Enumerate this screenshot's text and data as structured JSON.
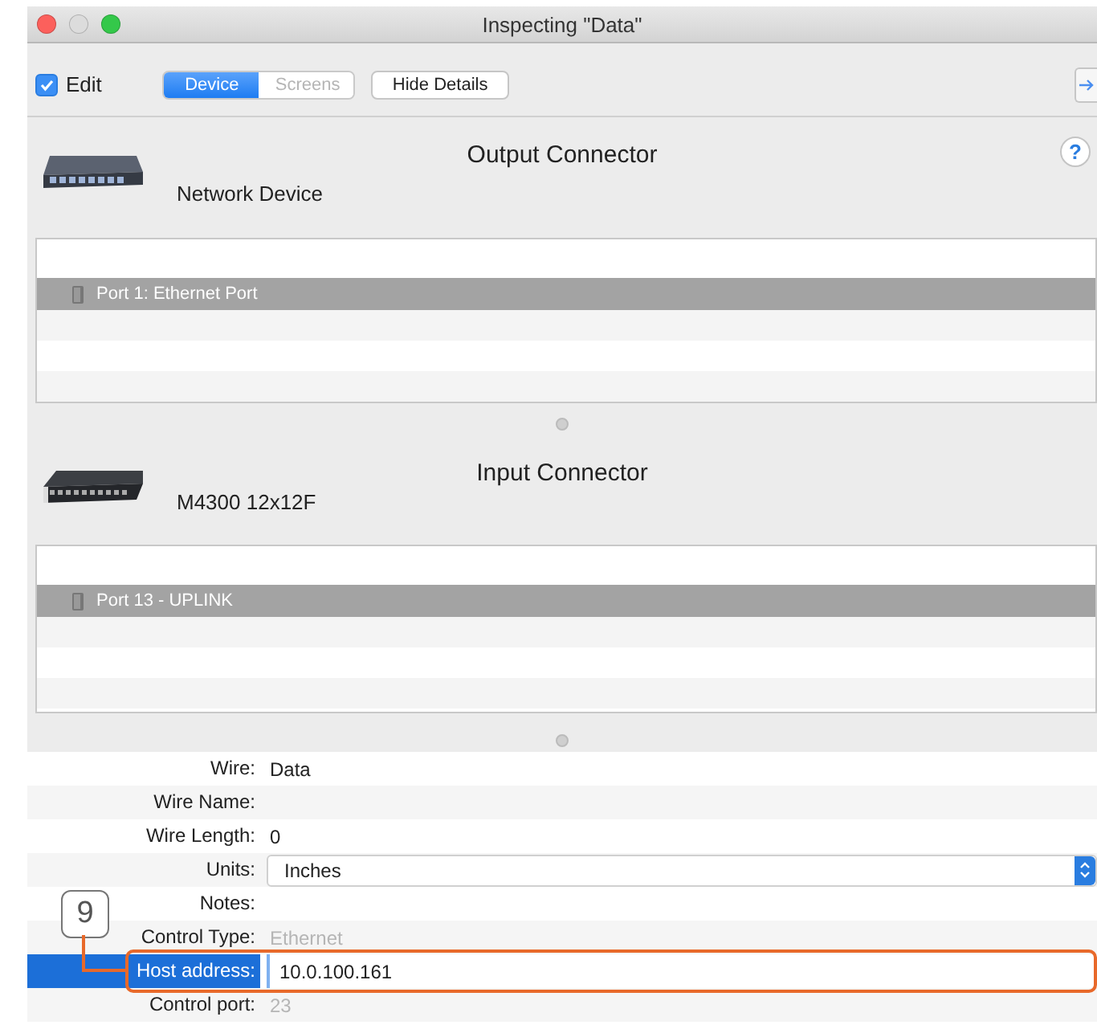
{
  "window": {
    "title": "Inspecting \"Data\""
  },
  "toolbar": {
    "edit": {
      "label": "Edit",
      "checked": true
    },
    "segments": [
      {
        "label": "Device",
        "selected": true
      },
      {
        "label": "Screens",
        "selected": false
      }
    ],
    "hide_details": "Hide Details"
  },
  "connectors": [
    {
      "heading": "Output Connector",
      "device": "Network Device",
      "kind": "switch-small",
      "help": "?",
      "ports": [
        {
          "label": "Port 1: Ethernet Port",
          "selected": true
        }
      ]
    },
    {
      "heading": "Input Connector",
      "device": "M4300 12x12F",
      "kind": "switch-rack",
      "ports": [
        {
          "label": "Port 13 - UPLINK",
          "selected": true
        }
      ]
    }
  ],
  "properties": [
    {
      "label": "Wire:",
      "kind": "text",
      "value": "Data",
      "disabled": false,
      "selected": false
    },
    {
      "label": "Wire Name:",
      "kind": "text",
      "selected": false
    },
    {
      "label": "Wire Length:",
      "kind": "text",
      "value": "0",
      "disabled": false,
      "selected": false
    },
    {
      "label": "Units:",
      "kind": "select",
      "value": "Inches",
      "selected": false
    },
    {
      "label": "Notes:",
      "kind": "text",
      "selected": false
    },
    {
      "label": "Control Type:",
      "kind": "text",
      "value": "Ethernet",
      "disabled": true,
      "selected": false
    },
    {
      "label": "Host address:",
      "kind": "field",
      "value": "10.0.100.161",
      "selected": true
    },
    {
      "label": "Control port:",
      "kind": "text",
      "value": "23",
      "disabled": true,
      "selected": false
    }
  ],
  "callout": {
    "number": "9"
  }
}
